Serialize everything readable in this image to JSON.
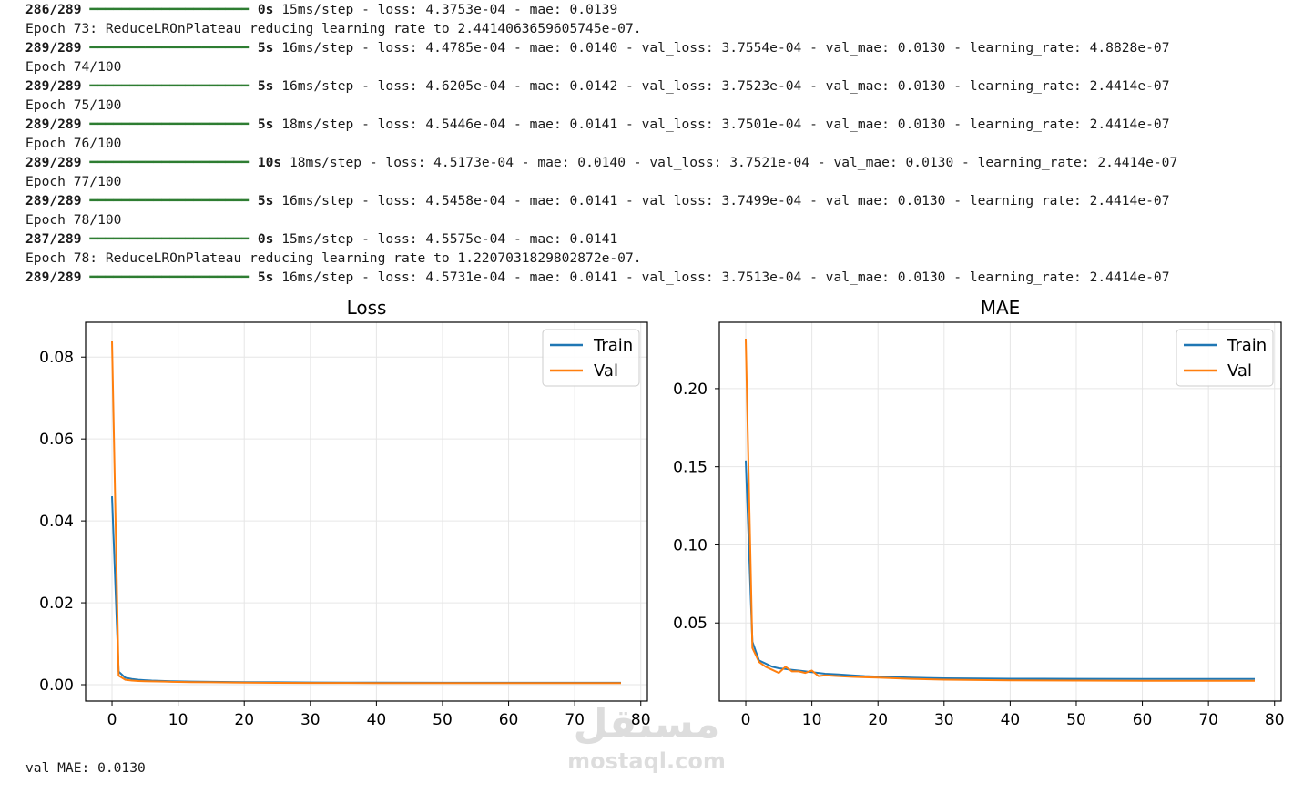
{
  "log": {
    "lines": [
      {
        "kind": "progress",
        "step": "286/289",
        "bar": "━━━━━━━━━━━━━━━━━━━━",
        "secs": "0s",
        "rest": " 15ms/step - loss: 4.3753e-04 - mae: 0.0139"
      },
      {
        "kind": "text",
        "text": "Epoch 73: ReduceLROnPlateau reducing learning rate to 2.4414063659605745e-07."
      },
      {
        "kind": "progress",
        "step": "289/289",
        "bar": "━━━━━━━━━━━━━━━━━━━━",
        "secs": "5s",
        "rest": " 16ms/step - loss: 4.4785e-04 - mae: 0.0140 - val_loss: 3.7554e-04 - val_mae: 0.0130 - learning_rate: 4.8828e-07"
      },
      {
        "kind": "text",
        "text": "Epoch 74/100"
      },
      {
        "kind": "progress",
        "step": "289/289",
        "bar": "━━━━━━━━━━━━━━━━━━━━",
        "secs": "5s",
        "rest": " 16ms/step - loss: 4.6205e-04 - mae: 0.0142 - val_loss: 3.7523e-04 - val_mae: 0.0130 - learning_rate: 2.4414e-07"
      },
      {
        "kind": "text",
        "text": "Epoch 75/100"
      },
      {
        "kind": "progress",
        "step": "289/289",
        "bar": "━━━━━━━━━━━━━━━━━━━━",
        "secs": "5s",
        "rest": " 18ms/step - loss: 4.5446e-04 - mae: 0.0141 - val_loss: 3.7501e-04 - val_mae: 0.0130 - learning_rate: 2.4414e-07"
      },
      {
        "kind": "text",
        "text": "Epoch 76/100"
      },
      {
        "kind": "progress",
        "step": "289/289",
        "bar": "━━━━━━━━━━━━━━━━━━━━",
        "secs": "10s",
        "rest": " 18ms/step - loss: 4.5173e-04 - mae: 0.0140 - val_loss: 3.7521e-04 - val_mae: 0.0130 - learning_rate: 2.4414e-07"
      },
      {
        "kind": "text",
        "text": "Epoch 77/100"
      },
      {
        "kind": "progress",
        "step": "289/289",
        "bar": "━━━━━━━━━━━━━━━━━━━━",
        "secs": "5s",
        "rest": " 16ms/step - loss: 4.5458e-04 - mae: 0.0141 - val_loss: 3.7499e-04 - val_mae: 0.0130 - learning_rate: 2.4414e-07"
      },
      {
        "kind": "text",
        "text": "Epoch 78/100"
      },
      {
        "kind": "progress",
        "step": "287/289",
        "bar": "━━━━━━━━━━━━━━━━━━━━",
        "secs": "0s",
        "rest": " 15ms/step - loss: 4.5575e-04 - mae: 0.0141"
      },
      {
        "kind": "text",
        "text": "Epoch 78: ReduceLROnPlateau reducing learning rate to 1.2207031829802872e-07."
      },
      {
        "kind": "progress",
        "step": "289/289",
        "bar": "━━━━━━━━━━━━━━━━━━━━",
        "secs": "5s",
        "rest": " 16ms/step - loss: 4.5731e-04 - mae: 0.0141 - val_loss: 3.7513e-04 - val_mae: 0.0130 - learning_rate: 2.4414e-07"
      }
    ]
  },
  "chart_data": [
    {
      "type": "line",
      "title": "Loss",
      "xlabel": "",
      "ylabel": "",
      "xlim": [
        -4,
        81
      ],
      "ylim": [
        -0.004,
        0.0885
      ],
      "xticks": [
        0,
        10,
        20,
        30,
        40,
        50,
        60,
        70,
        80
      ],
      "yticks": [
        0.0,
        0.02,
        0.04,
        0.06,
        0.08
      ],
      "ytick_labels": [
        "0.00",
        "0.02",
        "0.04",
        "0.06",
        "0.08"
      ],
      "grid": true,
      "legend": "top-right",
      "series": [
        {
          "name": "Train",
          "color": "#1f77b4",
          "x": [
            0,
            1,
            2,
            3,
            4,
            5,
            6,
            7,
            8,
            9,
            10,
            12,
            15,
            20,
            25,
            30,
            40,
            50,
            60,
            70,
            77
          ],
          "y": [
            0.046,
            0.0032,
            0.0017,
            0.0014,
            0.0012,
            0.0011,
            0.001,
            0.00095,
            0.0009,
            0.00085,
            0.0008,
            0.00075,
            0.0007,
            0.00062,
            0.00057,
            0.00053,
            0.0005,
            0.00048,
            0.00047,
            0.00046,
            0.00046
          ]
        },
        {
          "name": "Val",
          "color": "#ff7f0e",
          "x": [
            0,
            1,
            2,
            3,
            4,
            5,
            6,
            7,
            8,
            9,
            10,
            12,
            15,
            20,
            25,
            30,
            40,
            50,
            60,
            70,
            77
          ],
          "y": [
            0.084,
            0.0022,
            0.0012,
            0.001,
            0.0009,
            0.00085,
            0.0008,
            0.00078,
            0.00075,
            0.0007,
            0.00068,
            0.00062,
            0.00058,
            0.0005,
            0.00045,
            0.00042,
            0.0004,
            0.00039,
            0.00038,
            0.000375,
            0.000375
          ]
        }
      ]
    },
    {
      "type": "line",
      "title": "MAE",
      "xlabel": "",
      "ylabel": "",
      "xlim": [
        -4,
        81
      ],
      "ylim": [
        0.0,
        0.2425
      ],
      "xticks": [
        0,
        10,
        20,
        30,
        40,
        50,
        60,
        70,
        80
      ],
      "yticks": [
        0.05,
        0.1,
        0.15,
        0.2
      ],
      "ytick_labels": [
        "0.05",
        "0.10",
        "0.15",
        "0.20"
      ],
      "grid": true,
      "legend": "top-right",
      "series": [
        {
          "name": "Train",
          "color": "#1f77b4",
          "x": [
            0,
            1,
            2,
            3,
            4,
            5,
            6,
            7,
            8,
            9,
            10,
            11,
            12,
            14,
            16,
            18,
            20,
            25,
            30,
            40,
            50,
            60,
            70,
            77
          ],
          "y": [
            0.154,
            0.038,
            0.026,
            0.024,
            0.022,
            0.021,
            0.0205,
            0.02,
            0.0195,
            0.019,
            0.0185,
            0.018,
            0.0175,
            0.017,
            0.0165,
            0.016,
            0.0157,
            0.015,
            0.0146,
            0.0143,
            0.0142,
            0.0141,
            0.0141,
            0.0141
          ]
        },
        {
          "name": "Val",
          "color": "#ff7f0e",
          "x": [
            0,
            1,
            2,
            3,
            4,
            5,
            6,
            7,
            8,
            9,
            10,
            11,
            12,
            14,
            16,
            18,
            20,
            25,
            30,
            40,
            50,
            60,
            70,
            77
          ],
          "y": [
            0.232,
            0.034,
            0.025,
            0.022,
            0.02,
            0.018,
            0.022,
            0.019,
            0.019,
            0.018,
            0.0195,
            0.016,
            0.0165,
            0.016,
            0.0155,
            0.0152,
            0.015,
            0.0142,
            0.0137,
            0.0133,
            0.0131,
            0.013,
            0.013,
            0.013
          ]
        }
      ]
    }
  ],
  "footer": {
    "text": "val MAE: 0.0130"
  },
  "watermark": {
    "arabic": "مستقل",
    "latin": "mostaql.com"
  }
}
